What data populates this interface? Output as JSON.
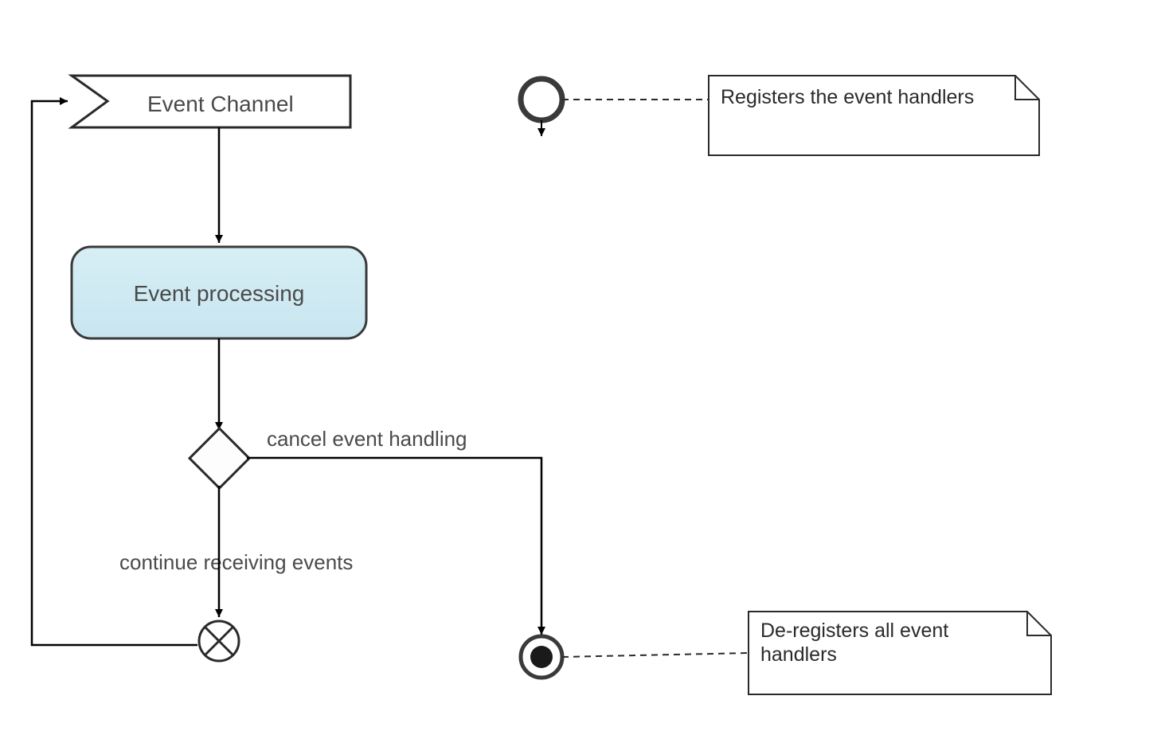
{
  "diagram": {
    "signalLabel": "Event Channel",
    "activityLabel": "Event processing",
    "decision": {
      "cancelLabel": "cancel event handling",
      "continueLabel": "continue receiving events"
    },
    "notes": {
      "register": "Registers the event handlers",
      "deregisterLine1": "De-registers all event",
      "deregisterLine2": "handlers"
    }
  }
}
